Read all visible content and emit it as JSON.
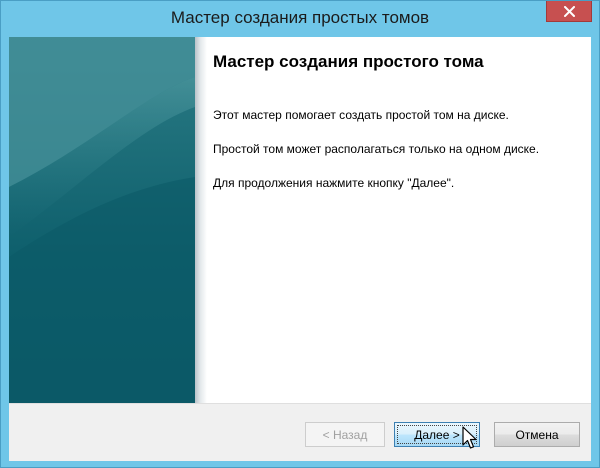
{
  "window": {
    "title": "Мастер создания простых томов"
  },
  "wizard": {
    "heading": "Мастер создания простого тома",
    "paragraphs": [
      "Этот мастер помогает создать простой том на диске.",
      "Простой том может располагаться только на одном диске.",
      "Для продолжения нажмите кнопку \"Далее\"."
    ]
  },
  "buttons": {
    "back_label": "< Назад",
    "back_enabled": false,
    "next_label": "Далее >",
    "cancel_label": "Отмена"
  },
  "icons": {
    "close": "close-icon",
    "cursor": "mouse-pointer-icon"
  },
  "colors": {
    "window_frame": "#6fc6e8",
    "close_button": "#c75050",
    "sidebar_top": "#2c7c86",
    "sidebar_bottom": "#0a5766",
    "next_button_border": "#3c7fb1"
  }
}
